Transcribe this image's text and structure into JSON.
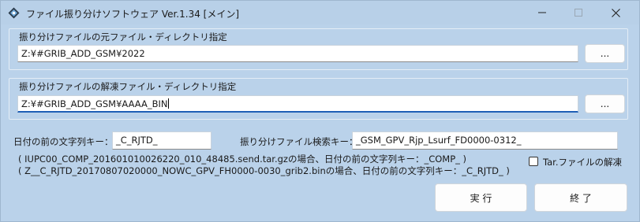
{
  "window": {
    "title": "ファイル振り分けソフトウェア Ver.1.34 [メイン]"
  },
  "source_group": {
    "title": "振り分けファイルの元ファイル・ディレクトリ指定",
    "path_value": "Z:¥#GRIB_ADD_GSM¥2022",
    "browse_label": "..."
  },
  "dest_group": {
    "title": "振り分けファイルの解凍ファイル・ディレクトリ指定",
    "path_value": "Z:¥#GRIB_ADD_GSM¥AAAA_BIN",
    "browse_label": "..."
  },
  "date_key": {
    "label": "日付の前の文字列キー：",
    "value": "_C_RJTD_"
  },
  "search_key": {
    "label": "振り分けファイル検索キー：",
    "value": "_GSM_GPV_Rjp_Lsurf_FD0000-0312_"
  },
  "notes": [
    "( IUPC00_COMP_201601010026220_010_48485.send.tar.gzの場合、日付の前の文字列キー：_COMP_ )",
    "( Z__C_RJTD_20170807020000_NOWC_GPV_FH0000-0030_grib2.binの場合、日付の前の文字列キー：_C_RJTD_ )"
  ],
  "tar_checkbox": {
    "label": "Tar.ファイルの解凍",
    "checked": false
  },
  "buttons": {
    "run_label": "実 行",
    "exit_label": "終 了"
  },
  "icons": {
    "app": "app-logo-icon",
    "minimize": "minimize-icon",
    "maximize": "maximize-icon",
    "close": "close-icon"
  }
}
